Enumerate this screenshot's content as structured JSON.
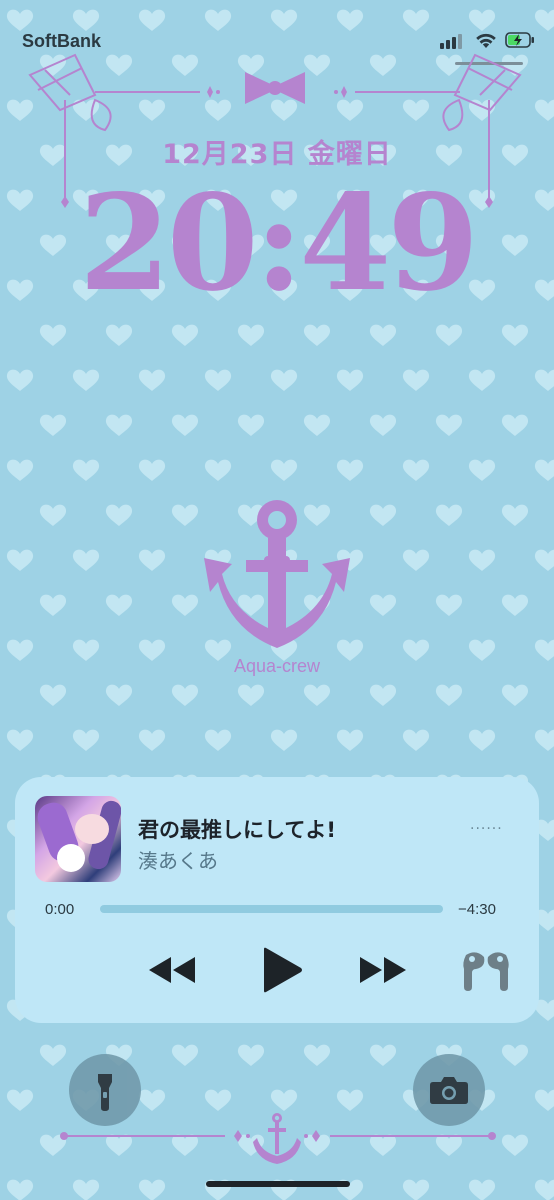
{
  "status_bar": {
    "carrier": "SoftBank",
    "signal_icon": "cellular-signal-icon",
    "wifi_icon": "wifi-icon",
    "battery_icon": "battery-charging-icon"
  },
  "lock_screen": {
    "date": "12月23日 金曜日",
    "time": "20:49",
    "wallpaper_caption": "Aqua-crew",
    "accent_color": "#b584cf"
  },
  "now_playing": {
    "title": "君の最推しにしてよ!",
    "artist": "湊あくあ",
    "elapsed": "0:00",
    "remaining": "−4:30",
    "progress": 0,
    "controls": [
      "rewind-icon",
      "play-icon",
      "fast-forward-icon",
      "airpods-icon"
    ]
  },
  "quick_actions": {
    "left": "flashlight-icon",
    "right": "camera-icon"
  }
}
